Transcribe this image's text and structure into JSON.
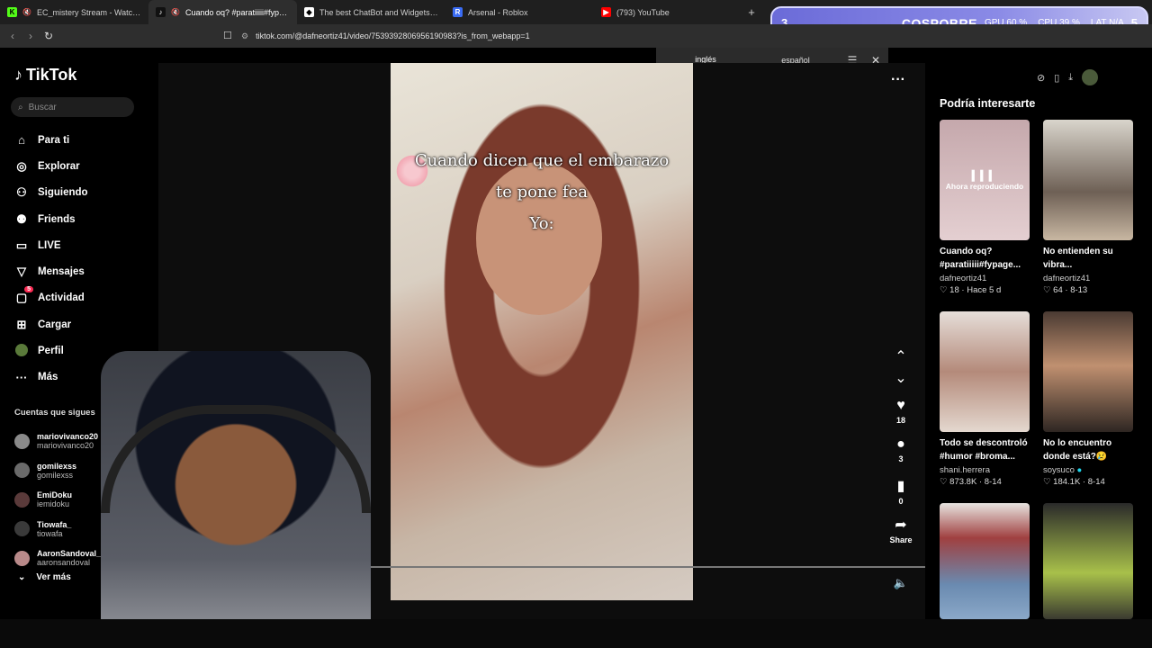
{
  "browser": {
    "tabs": [
      {
        "label": "EC_mistery Stream - Watch Live o",
        "icon": "kick-icon",
        "color": "#53fc18",
        "muted": true
      },
      {
        "label": "Cuando oq? #paratiiiii#fypage",
        "icon": "tiktok-icon",
        "color": "#111111",
        "muted": true,
        "active": true
      },
      {
        "label": "The best ChatBot and Widgets for Ki",
        "icon": "botrix-icon",
        "color": "#ffffff"
      },
      {
        "label": "Arsenal - Roblox",
        "icon": "roblox-icon",
        "color": "#3a6cf4"
      },
      {
        "label": "(793) YouTube",
        "icon": "youtube-icon",
        "color": "#ff0000"
      }
    ],
    "new_tab": "+",
    "url": "tiktok.com/@dafneortiz41/video/7539392806956190983?is_from_webapp=1"
  },
  "overlay": {
    "left_num": "3",
    "word": "COSPOBRE",
    "gpu": "GPU 60 %",
    "cpu": "CPU 39 %",
    "lat": "LAT N/A",
    "right_num": "5"
  },
  "translate": {
    "lang1": "inglés",
    "lang2": "español"
  },
  "sidebar": {
    "logo": "TikTok",
    "search_placeholder": "Buscar",
    "items": [
      {
        "label": "Para ti",
        "icon": "home-icon"
      },
      {
        "label": "Explorar",
        "icon": "compass-icon"
      },
      {
        "label": "Siguiendo",
        "icon": "following-icon"
      },
      {
        "label": "Friends",
        "icon": "friends-icon"
      },
      {
        "label": "LIVE",
        "icon": "live-icon"
      },
      {
        "label": "Mensajes",
        "icon": "send-icon"
      },
      {
        "label": "Actividad",
        "icon": "inbox-icon",
        "badge": "5"
      },
      {
        "label": "Cargar",
        "icon": "upload-icon"
      },
      {
        "label": "Perfil",
        "icon": "avatar-icon"
      },
      {
        "label": "Más",
        "icon": "more-icon"
      }
    ],
    "following_title": "Cuentas que sigues",
    "following": [
      {
        "name": "mariovivanco20",
        "handle": "mariovivanco20"
      },
      {
        "name": "gomilexss",
        "handle": "gomilexss"
      },
      {
        "name": "EmiDoku",
        "handle": "iemidoku"
      },
      {
        "name": "Tiowafa_",
        "handle": "tiowafa"
      },
      {
        "name": "AaronSandoval_",
        "handle": "aaronsandoval"
      }
    ],
    "see_more": "Ver más"
  },
  "video": {
    "caption_line1": "Cuando dicen que el embarazo",
    "caption_line2": "te pone fea",
    "caption_line3": "Yo:",
    "likes": "18",
    "comments": "3",
    "saves": "0",
    "share": "Share"
  },
  "right": {
    "title": "Podría interesarte",
    "cards": [
      {
        "title": "Cuando oq? #paratiiiii#fypage...",
        "author": "dafneortiz41",
        "likes": "18",
        "date": "Hace 5 d",
        "playing": "Ahora reproduciendo",
        "color": "#d3b8bc"
      },
      {
        "title": "No entienden su vibra...",
        "author": "dafneortiz41",
        "likes": "64",
        "date": "8-13",
        "color": "#8a7a6a"
      },
      {
        "title": "Todo se descontroló #humor #broma...",
        "author": "shani.herrera",
        "likes": "873.8K",
        "date": "8-14",
        "color": "#c9a79a"
      },
      {
        "title": "No lo encuentro donde está?😢",
        "author": "soysuco",
        "likes": "184.1K",
        "date": "8-14",
        "color": "#6f5a4a"
      },
      {
        "title": "",
        "author": "",
        "likes": "",
        "date": "",
        "color": "#6a8ab0"
      },
      {
        "title": "",
        "author": "",
        "likes": "",
        "date": "",
        "color": "#4a4a42"
      }
    ]
  }
}
